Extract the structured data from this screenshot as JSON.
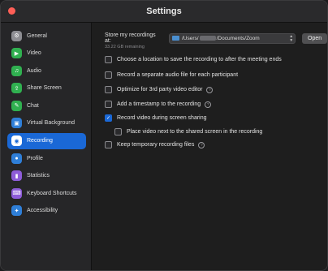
{
  "window": {
    "title": "Settings"
  },
  "sidebar": {
    "items": [
      {
        "label": "General",
        "icon": "gear-icon",
        "color": "#8e8e93",
        "glyph": "⚙"
      },
      {
        "label": "Video",
        "icon": "video-camera-icon",
        "color": "#30b050",
        "glyph": "▶"
      },
      {
        "label": "Audio",
        "icon": "headphones-icon",
        "color": "#30b050",
        "glyph": "♫"
      },
      {
        "label": "Share Screen",
        "icon": "share-screen-icon",
        "color": "#30b050",
        "glyph": "⇪"
      },
      {
        "label": "Chat",
        "icon": "chat-bubble-icon",
        "color": "#30b050",
        "glyph": "✎"
      },
      {
        "label": "Virtual Background",
        "icon": "virtual-background-icon",
        "color": "#2f7fd8",
        "glyph": "▣"
      },
      {
        "label": "Recording",
        "icon": "record-icon",
        "color": "#1a68d6",
        "glyph": "◉",
        "active": true
      },
      {
        "label": "Profile",
        "icon": "profile-icon",
        "color": "#2f7fd8",
        "glyph": "●"
      },
      {
        "label": "Statistics",
        "icon": "statistics-icon",
        "color": "#8e5cd8",
        "glyph": "▮"
      },
      {
        "label": "Keyboard Shortcuts",
        "icon": "keyboard-icon",
        "color": "#8e5cd8",
        "glyph": "⌨"
      },
      {
        "label": "Accessibility",
        "icon": "accessibility-icon",
        "color": "#2f7fd8",
        "glyph": "✦"
      }
    ]
  },
  "recording": {
    "store_label": "Store my recordings at:",
    "path": "/Users/",
    "path_suffix": "/Documents/Zoom",
    "open_label": "Open",
    "remaining": "33.22 GB remaining",
    "options": [
      {
        "label": "Choose a location to save the recording to after the meeting ends",
        "checked": false,
        "info": false
      },
      {
        "label": "Record a separate audio file for each participant",
        "checked": false,
        "info": false
      },
      {
        "label": "Optimize for 3rd party video editor",
        "checked": false,
        "info": true
      },
      {
        "label": "Add a timestamp to the recording",
        "checked": false,
        "info": true
      },
      {
        "label": "Record video during screen sharing",
        "checked": true,
        "info": false
      },
      {
        "label": "Place video next to the shared screen in the recording",
        "checked": false,
        "info": false,
        "indent": true
      },
      {
        "label": "Keep temporary recording files",
        "checked": false,
        "info": true
      }
    ]
  }
}
